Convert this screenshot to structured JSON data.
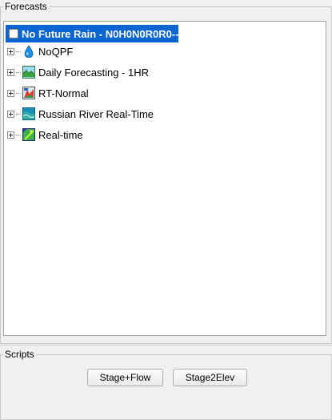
{
  "forecasts": {
    "title": "Forecasts",
    "root": {
      "label": "No Future Rain - N0H0N0R0R0--"
    },
    "items": [
      {
        "label": "NoQPF",
        "icon": "water-drop-icon"
      },
      {
        "label": "Daily Forecasting - 1HR",
        "icon": "landscape-chart-icon"
      },
      {
        "label": "RT-Normal",
        "icon": "map-flag-icon"
      },
      {
        "label": "Russian River Real-Time",
        "icon": "river-wave-icon"
      },
      {
        "label": "Real-time",
        "icon": "realtime-map-icon"
      }
    ]
  },
  "scripts": {
    "title": "Scripts",
    "buttons": [
      {
        "label": "Stage+Flow"
      },
      {
        "label": "Stage2Elev"
      }
    ]
  }
}
